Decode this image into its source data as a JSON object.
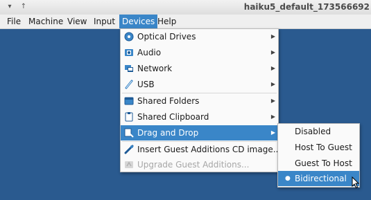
{
  "window": {
    "title": "haiku5_default_173566692",
    "controls": [
      "chevron-down-icon",
      "arrow-up-icon"
    ]
  },
  "menubar": {
    "items": [
      "File",
      "Machine",
      "View",
      "Input",
      "Devices",
      "Help"
    ],
    "active": "Devices"
  },
  "devices_menu": {
    "items": [
      {
        "label": "Optical Drives",
        "icon": "optical-drive-icon",
        "submenu": true
      },
      {
        "label": "Audio",
        "icon": "audio-icon",
        "submenu": true
      },
      {
        "label": "Network",
        "icon": "network-icon",
        "submenu": true
      },
      {
        "label": "USB",
        "icon": "usb-icon",
        "submenu": true
      },
      {
        "label": "Shared Folders",
        "icon": "folder-icon",
        "submenu": true
      },
      {
        "label": "Shared Clipboard",
        "icon": "clipboard-icon",
        "submenu": true
      },
      {
        "label": "Drag and Drop",
        "icon": "drag-drop-icon",
        "submenu": true,
        "highlighted": true
      },
      {
        "label": "Insert Guest Additions CD image...",
        "icon": "insert-cd-icon",
        "submenu": false
      },
      {
        "label": "Upgrade Guest Additions...",
        "icon": "upgrade-icon",
        "submenu": false,
        "disabled": true
      }
    ]
  },
  "drag_drop_submenu": {
    "items": [
      {
        "label": "Disabled",
        "selected": false
      },
      {
        "label": "Host To Guest",
        "selected": false
      },
      {
        "label": "Guest To Host",
        "selected": false
      },
      {
        "label": "Bidirectional",
        "selected": true,
        "highlighted": true
      }
    ],
    "bullet": "●"
  },
  "colors": {
    "desktop": "#2a5a8f",
    "highlight": "#3a86c8"
  }
}
